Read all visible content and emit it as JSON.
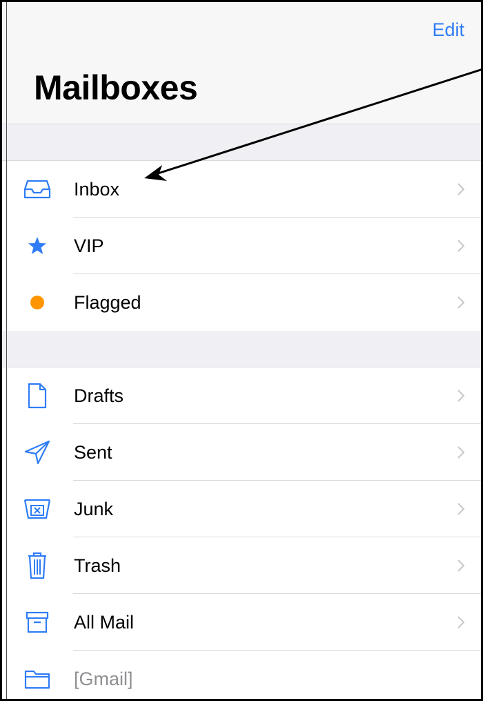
{
  "header": {
    "edit_label": "Edit",
    "title": "Mailboxes"
  },
  "colors": {
    "accent": "#2f7cf6",
    "flag": "#ff9500",
    "chevron": "#c7c7cc",
    "muted_text": "#8e8e93"
  },
  "groups": [
    {
      "items": [
        {
          "label": "Inbox",
          "icon": "inbox-tray-icon",
          "chevron": true
        },
        {
          "label": "VIP",
          "icon": "star-icon",
          "chevron": true
        },
        {
          "label": "Flagged",
          "icon": "flag-dot-icon",
          "chevron": true
        }
      ]
    },
    {
      "items": [
        {
          "label": "Drafts",
          "icon": "document-icon",
          "chevron": true
        },
        {
          "label": "Sent",
          "icon": "paper-plane-icon",
          "chevron": true
        },
        {
          "label": "Junk",
          "icon": "junk-box-icon",
          "chevron": true
        },
        {
          "label": "Trash",
          "icon": "trash-can-icon",
          "chevron": true
        },
        {
          "label": "All Mail",
          "icon": "archive-box-icon",
          "chevron": true
        },
        {
          "label": "[Gmail]",
          "icon": "folder-icon",
          "chevron": false
        }
      ]
    }
  ],
  "annotation": {
    "icon": "callout-arrow-icon",
    "points_to": "Inbox"
  }
}
